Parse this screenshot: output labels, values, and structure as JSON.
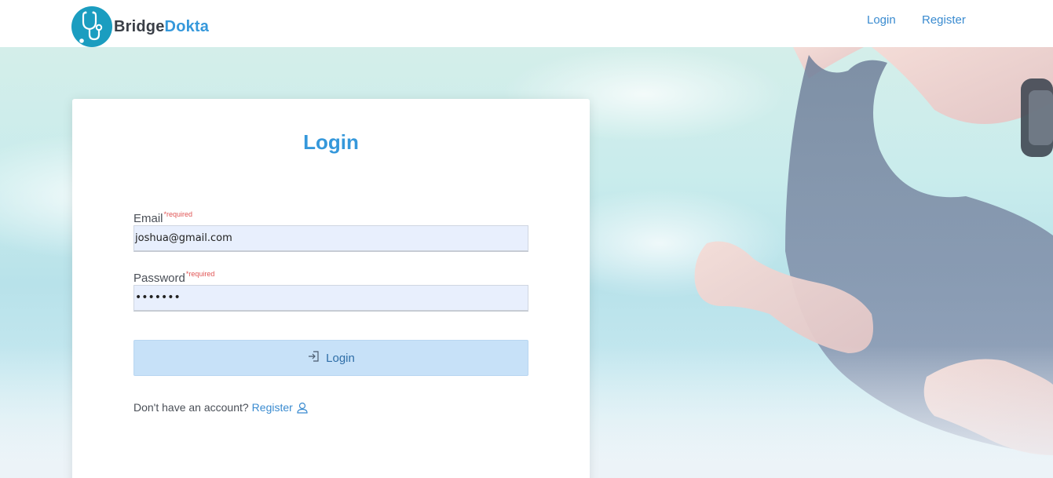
{
  "brand": {
    "name_part1": "Bridge",
    "name_part2": "Dokta",
    "logo_icon": "stethoscope-icon",
    "logo_color": "#1b9dc0"
  },
  "nav": {
    "login_label": "Login",
    "register_label": "Register"
  },
  "card": {
    "title": "Login",
    "email": {
      "label": "Email",
      "required_tag": "*required",
      "value": "joshua@gmail.com"
    },
    "password": {
      "label": "Password",
      "required_tag": "*required",
      "masked_value": "•••••••"
    },
    "login_button": {
      "label": "Login",
      "icon": "sign-in-icon"
    },
    "register_prompt": {
      "text": "Don't have an account?",
      "link_label": "Register",
      "icon": "user-icon"
    }
  },
  "colors": {
    "accent": "#3598db",
    "input_bg": "#e8effd",
    "button_bg": "#c7e1f8",
    "required": "#e05555"
  }
}
